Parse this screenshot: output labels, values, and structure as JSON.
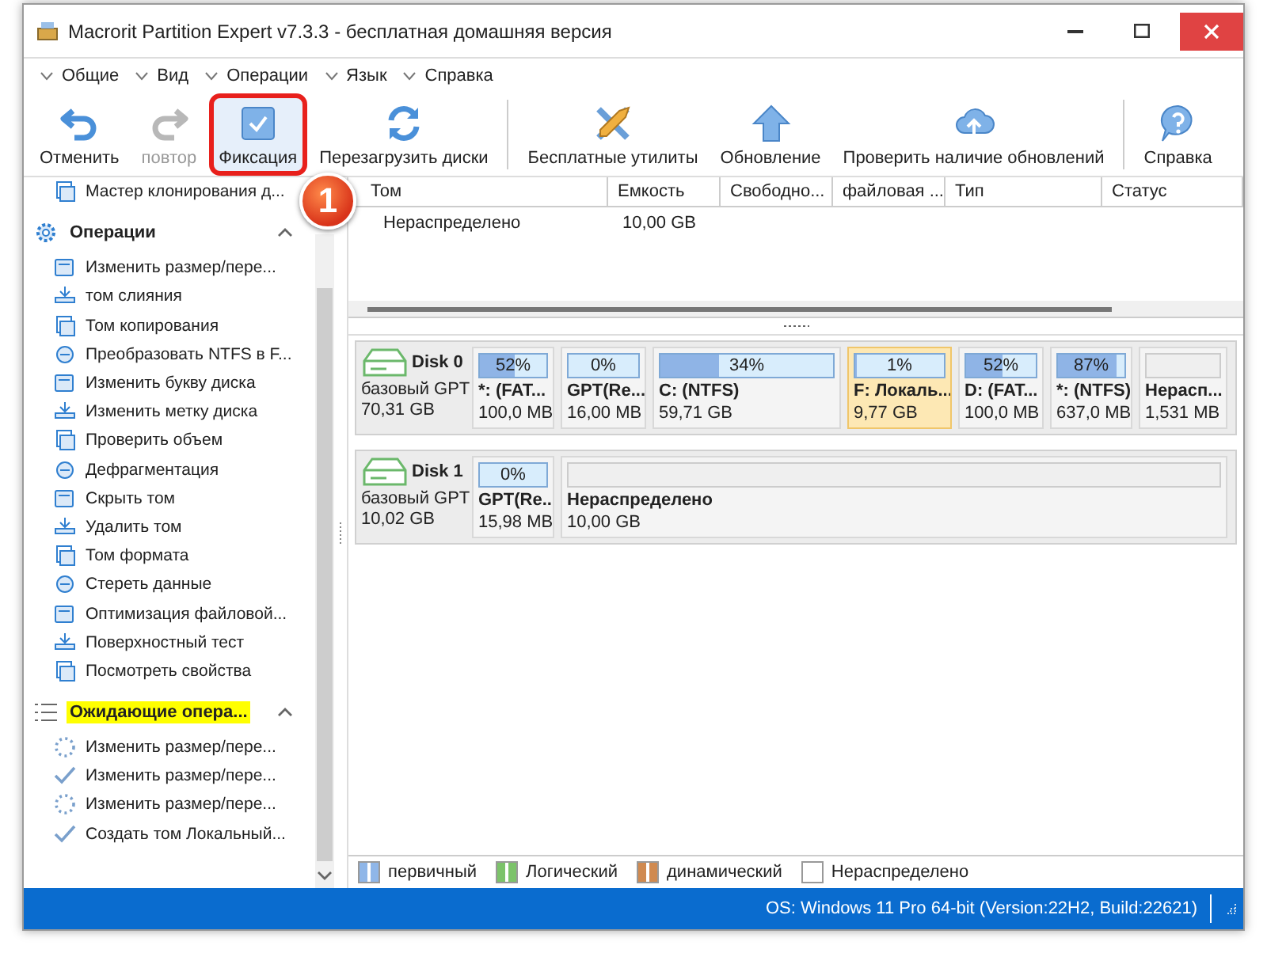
{
  "window": {
    "title": "Macrorit Partition Expert v7.3.3 - бесплатная домашняя версия"
  },
  "menu": [
    "Общие",
    "Вид",
    "Операции",
    "Язык",
    "Справка"
  ],
  "toolbar": [
    [
      {
        "label": "Отменить",
        "disabled": false,
        "highlighted": false
      },
      {
        "label": "повтор",
        "disabled": true,
        "highlighted": false
      },
      {
        "label": "Фиксация",
        "disabled": false,
        "highlighted": true
      },
      {
        "label": "Перезагрузить диски",
        "disabled": false,
        "highlighted": false
      }
    ],
    [
      {
        "label": "Бесплатные утилиты",
        "disabled": false,
        "highlighted": false
      },
      {
        "label": "Обновление",
        "disabled": false,
        "highlighted": false
      },
      {
        "label": "Проверить наличие обновлений",
        "disabled": false,
        "highlighted": false
      }
    ],
    [
      {
        "label": "Справка",
        "disabled": false,
        "highlighted": false
      }
    ]
  ],
  "annotation": {
    "badge": "1"
  },
  "sidebar": {
    "top_item": "Мастер клонирования д...",
    "sections": [
      {
        "kind": "operations",
        "title": "Операции",
        "highlighted": false,
        "expanded": true,
        "items": [
          {
            "label": "Изменить размер/пере..."
          },
          {
            "label": "том слияния"
          },
          {
            "label": "Том копирования"
          },
          {
            "label": "Преобразовать NTFS в F..."
          },
          {
            "label": "Изменить букву диска"
          },
          {
            "label": "Изменить метку диска"
          },
          {
            "label": "Проверить объем"
          },
          {
            "label": "Дефрагментация"
          },
          {
            "label": "Скрыть том"
          },
          {
            "label": "Удалить том"
          },
          {
            "label": "Том формата"
          },
          {
            "label": "Стереть данные"
          },
          {
            "label": "Оптимизация файловой..."
          },
          {
            "label": "Поверхностный тест"
          },
          {
            "label": "Посмотреть свойства"
          }
        ]
      },
      {
        "kind": "pending",
        "title": "Ожидающие опера...",
        "highlighted": true,
        "expanded": true,
        "items": [
          {
            "label": "Изменить размер/пере...",
            "done": false
          },
          {
            "label": "Изменить размер/пере...",
            "done": true
          },
          {
            "label": "Изменить размер/пере...",
            "done": false
          },
          {
            "label": "Создать том Локальный...",
            "done": true
          }
        ]
      }
    ]
  },
  "table": {
    "columns": [
      "Том",
      "Емкость",
      "Свободно...",
      "файловая ...",
      "Тип",
      "Статус"
    ],
    "rows": [
      {
        "cells": [
          "Нераспределено",
          "10,00 GB"
        ]
      }
    ]
  },
  "disks": [
    {
      "name": "Disk 0",
      "type": "базовый GPT",
      "size": "70,31 GB",
      "partitions": [
        {
          "kind": "used",
          "label": "*: (FAT...",
          "size": "100,0 MB",
          "percent": "52%",
          "level": 0.52,
          "selected": false
        },
        {
          "kind": "used",
          "label": "GPT(Re...",
          "size": "16,00 MB",
          "percent": "0%",
          "level": 0,
          "selected": false
        },
        {
          "kind": "used",
          "label": "C: (NTFS)",
          "size": "59,71 GB",
          "percent": "34%",
          "level": 0.34,
          "selected": false
        },
        {
          "kind": "used",
          "label": "F: Локаль...",
          "size": "9,77 GB",
          "percent": "1%",
          "level": 0.01,
          "selected": true
        },
        {
          "kind": "used",
          "label": "D: (FAT...",
          "size": "100,0 MB",
          "percent": "52%",
          "level": 0.52,
          "selected": false
        },
        {
          "kind": "used",
          "label": "*: (NTFS)",
          "size": "637,0 MB",
          "percent": "87%",
          "level": 0.87,
          "selected": false
        },
        {
          "kind": "unallocated",
          "label": "Нерасп...",
          "size": "1,531 MB",
          "selected": false
        }
      ]
    },
    {
      "name": "Disk 1",
      "type": "базовый GPT",
      "size": "10,02 GB",
      "partitions": [
        {
          "kind": "used",
          "label": "GPT(Re...",
          "size": "15,98 MB",
          "percent": "0%",
          "level": 0,
          "selected": false
        },
        {
          "kind": "unallocated",
          "label": "Нераспределено",
          "size": "10,00 GB",
          "selected": false
        }
      ]
    }
  ],
  "legend": [
    {
      "label": "первичный",
      "color": "#8fb6e8"
    },
    {
      "label": "Логический",
      "color": "#7cc36a"
    },
    {
      "label": "динамический",
      "color": "#d08a50"
    },
    {
      "label": "Нераспределено",
      "color": "#ffffff"
    }
  ],
  "status": "OS: Windows 11 Pro 64-bit (Version:22H2, Build:22621)"
}
